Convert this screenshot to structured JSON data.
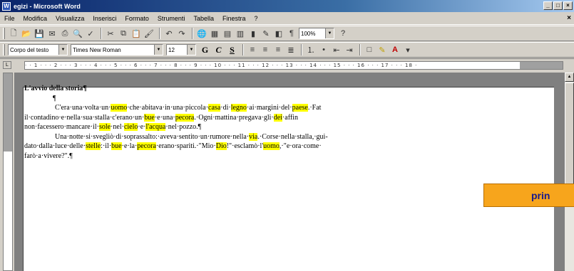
{
  "window": {
    "title": "egizi - Microsoft Word",
    "buttons": [
      "_",
      "□",
      "×"
    ],
    "doc_close": "×"
  },
  "menu": [
    "File",
    "Modifica",
    "Visualizza",
    "Inserisci",
    "Formato",
    "Strumenti",
    "Tabella",
    "Finestra",
    "?"
  ],
  "standard_toolbar": {
    "zoom": "100%",
    "help": "?"
  },
  "format_toolbar": {
    "style": "Corpo del testo",
    "font": "Times New Roman",
    "size": "12",
    "bold": "G",
    "italic": "C",
    "underline": "S"
  },
  "ruler": {
    "text": "· · 1 · · · 2 · · · 3 · · · 4 · · · 5 · · · 6 · · · 7 · · · 8 · · · 9 · · · 10 · · · 11 · · · 12 · · · 13 · · · 14 · · · 15 · · · 16 · · · 17 · · · 18 ·"
  },
  "document": {
    "heading": "L'avvio della storia¶",
    "pilcrow": "¶",
    "paragraph1": [
      {
        "t": "C'era·una·volta·un·",
        "h": false
      },
      {
        "t": "uomo",
        "h": true
      },
      {
        "t": "·che·abitava·in·una·piccola·",
        "h": false
      },
      {
        "t": "casa",
        "h": true
      },
      {
        "t": "·di·",
        "h": false
      },
      {
        "t": "legno",
        "h": true
      },
      {
        "t": "·ai·margini·del·",
        "h": false
      },
      {
        "t": "paese",
        "h": true
      },
      {
        "t": ".·Fat",
        "h": false
      }
    ],
    "paragraph1_line2": [
      {
        "t": "il·contadino·e·nella·sua·stalla·c'erano·un·",
        "h": false
      },
      {
        "t": "bue",
        "h": true
      },
      {
        "t": "·e·una·",
        "h": false
      },
      {
        "t": "pecora",
        "h": true
      },
      {
        "t": ".·Ogni·mattina·pregava·gli·",
        "h": false
      },
      {
        "t": "dei",
        "h": true
      },
      {
        "t": "·affin",
        "h": false
      }
    ],
    "paragraph1_line3": [
      {
        "t": "non·facessero·mancare·il·",
        "h": false
      },
      {
        "t": "sole",
        "h": true
      },
      {
        "t": "·nel·",
        "h": false
      },
      {
        "t": "cielo",
        "h": true
      },
      {
        "t": "·e·",
        "h": false
      },
      {
        "t": "l'acqua",
        "h": true
      },
      {
        "t": "·nel·pozzo.¶",
        "h": false
      }
    ],
    "paragraph2": [
      {
        "t": "Una·notte·si·svegliò·di·soprassalto:·aveva·sentito·un·rumore·nella·",
        "h": false
      },
      {
        "t": "via",
        "h": true
      },
      {
        "t": ".·Corse·nella·stalla,·gui-",
        "h": false
      }
    ],
    "paragraph2_line2": [
      {
        "t": "dato·dalla·luce·delle·",
        "h": false
      },
      {
        "t": "stelle",
        "h": true
      },
      {
        "t": ":·il·",
        "h": false
      },
      {
        "t": "bue",
        "h": true
      },
      {
        "t": "·e·la·",
        "h": false
      },
      {
        "t": "pecora",
        "h": true
      },
      {
        "t": "·erano·spariti.·\"Mio·",
        "h": false
      },
      {
        "t": "Dio",
        "h": true
      },
      {
        "t": "!\"·esclamò·l'",
        "h": false
      },
      {
        "t": "uomo",
        "h": true
      },
      {
        "t": ",·\"e·ora·come·",
        "h": false
      }
    ],
    "paragraph2_line3": [
      {
        "t": "farò·a·vivere?\".¶",
        "h": false
      }
    ]
  },
  "banner": {
    "text": "prin"
  },
  "colors": {
    "highlight": "#ffff00",
    "banner": "#f7a51c",
    "banner_text": "#1a1a8c"
  }
}
